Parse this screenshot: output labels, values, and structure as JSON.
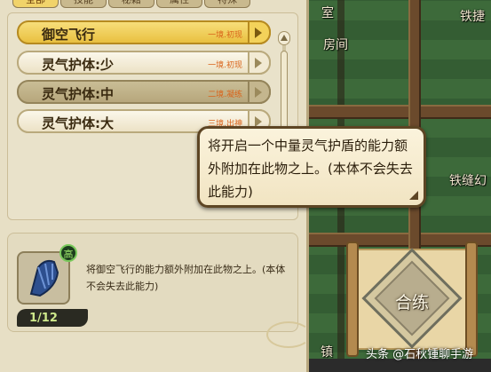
{
  "tabs": [
    "全部",
    "技能",
    "秘籍",
    "属性",
    "特殊"
  ],
  "active_tab_index": 0,
  "skills": [
    {
      "name": "御空飞行",
      "realm": "一境.初现",
      "state": "selected"
    },
    {
      "name": "灵气护体:少",
      "realm": "一境.初现",
      "state": "normal"
    },
    {
      "name": "灵气护体:中",
      "realm": "二境.凝练",
      "state": "dim"
    },
    {
      "name": "灵气护体:大",
      "realm": "三境.出神",
      "state": "normal"
    }
  ],
  "detail": {
    "badge": "高",
    "level": "1/12",
    "description": "将御空飞行的能力额外附加在此物之上。(本体不会失去此能力)"
  },
  "tooltip": {
    "text": "将开启一个中量灵气护盾的能力额外附加在此物之上。(本体不会失去此能力)"
  },
  "emblem_button": {
    "label": "合练"
  },
  "map_labels": [
    {
      "id": "top-left",
      "text": "室"
    },
    {
      "id": "top-right",
      "text": "铁捷"
    },
    {
      "id": "room",
      "text": "房间"
    },
    {
      "id": "right-mid",
      "text": "铁缝幻"
    },
    {
      "id": "bottom-left",
      "text": "镇"
    }
  ],
  "watermark": "头条 @石秋锺聊手游",
  "colors": {
    "panel_bg": "#e7dfc5",
    "selected_row": "#f3d25a",
    "realm_text": "#d9631a",
    "badge_green": "#79c95b"
  },
  "icons": {
    "skill_icon": "feather-crystal-icon",
    "scroll_up": "chevron-up-icon",
    "row_arrow": "caret-right-icon"
  }
}
